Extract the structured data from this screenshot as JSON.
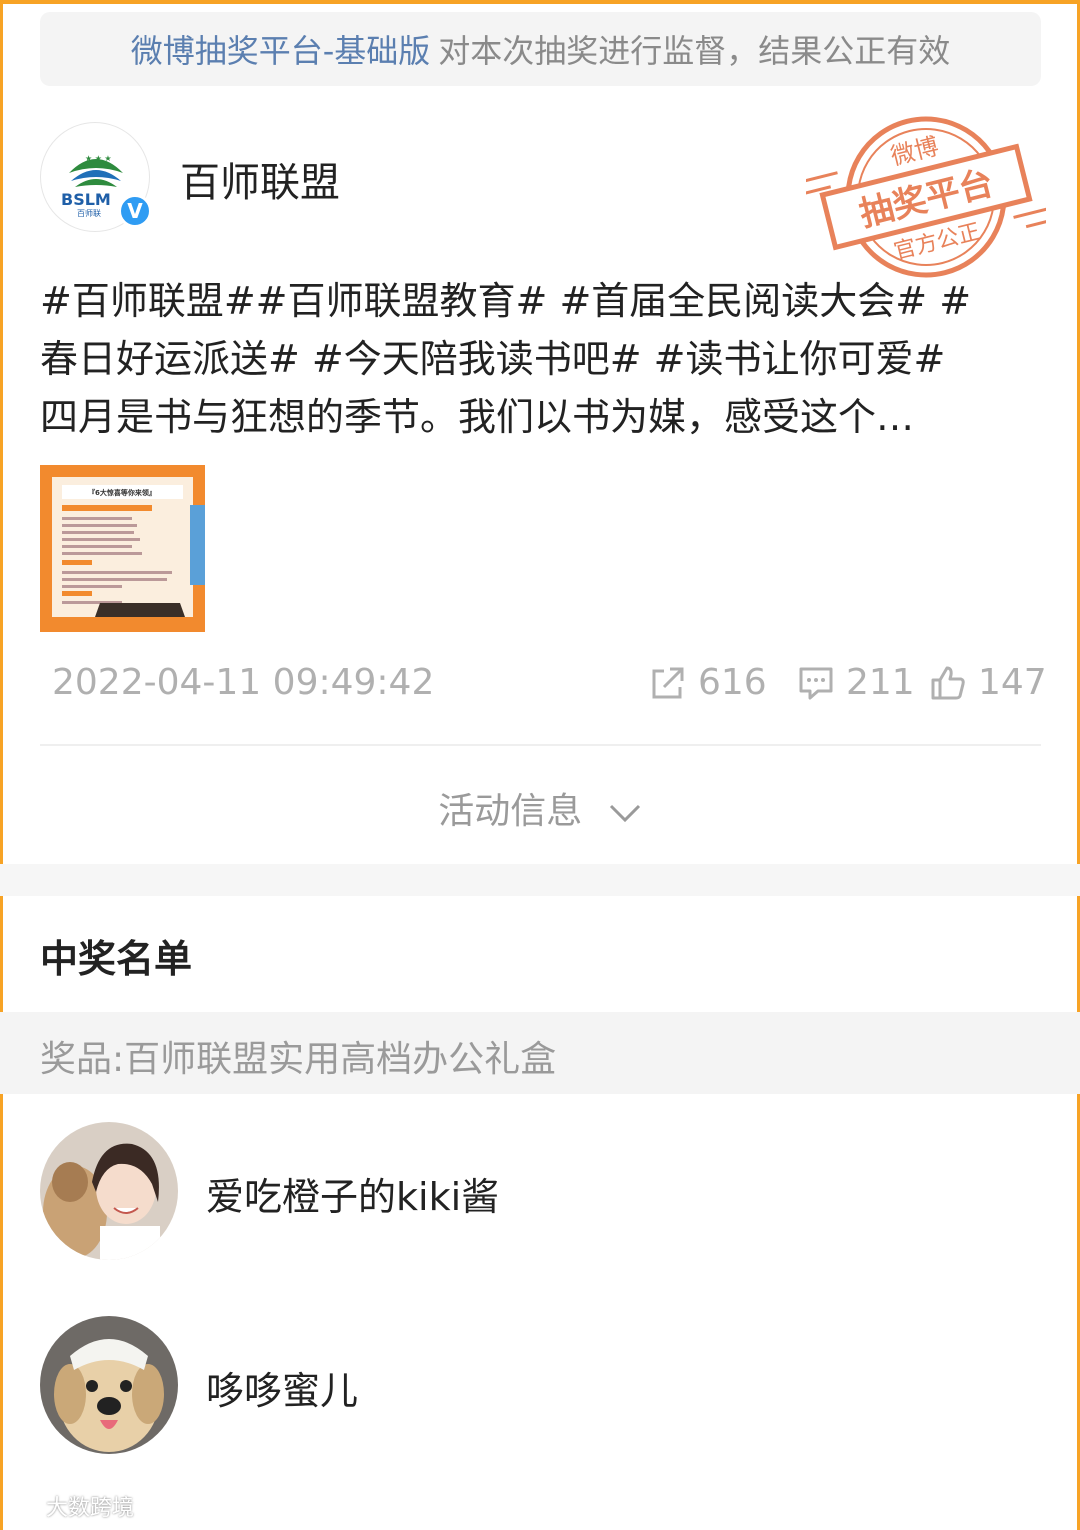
{
  "notice": {
    "link_text": "微博抽奖平台-基础版",
    "rest_text": "对本次抽奖进行监督，结果公正有效"
  },
  "post": {
    "author": "百师联盟",
    "avatar_logo_text": "BSLM",
    "avatar_logo_sub": "百师联",
    "verified_icon": "v-badge",
    "stamp": {
      "line1": "微博",
      "line2": "抽奖平台",
      "line3": "官方公正"
    },
    "text_lines": [
      "#百师联盟##百师联盟教育# #首届全民阅读大会# #",
      "春日好运派送# #今天陪我读书吧# #读书让你可爱#",
      "四月是书与狂想的季节。我们以书为媒，感受这个…"
    ],
    "image": {
      "title": "『6大惊喜等你来领』"
    },
    "timestamp": "2022-04-11 09:49:42",
    "reposts": "616",
    "comments": "211",
    "likes": "147"
  },
  "activity": {
    "label": "活动信息"
  },
  "winners": {
    "title": "中奖名单",
    "prize_label": "奖品:百师联盟实用高档办公礼盒",
    "list": [
      {
        "name": "爱吃橙子的kiki酱"
      },
      {
        "name": "哆哆蜜儿"
      }
    ]
  },
  "watermark": {
    "text": "大数跨境"
  },
  "colors": {
    "accent_orange": "#f7a325",
    "link_blue": "#5b7fb0",
    "stamp_orange": "#e8825a",
    "verified_blue": "#2f9cf3"
  }
}
